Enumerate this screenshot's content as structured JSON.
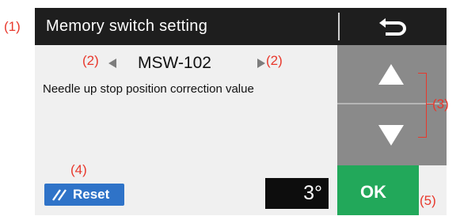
{
  "window": {
    "title": "Memory switch setting",
    "back_icon": "return-arrow-icon"
  },
  "switch": {
    "id": "MSW-102",
    "prev_icon": "triangle-left-icon",
    "next_icon": "triangle-right-icon",
    "description": "Needle up stop position correction value"
  },
  "actions": {
    "reset_label": "Reset",
    "reset_icon": "reset-slash-icon",
    "ok_label": "OK",
    "up_icon": "triangle-up-icon",
    "down_icon": "triangle-down-icon"
  },
  "value": {
    "display": "3°"
  },
  "callouts": {
    "c1": "(1)",
    "c2_left": "(2)",
    "c2_right": "(2)",
    "c3": "(3)",
    "c4": "(4)",
    "c5": "(5)"
  },
  "colors": {
    "title_bg": "#1e1e1e",
    "panel_bg": "#f0f0f0",
    "nav_bg": "#8a8a8a",
    "reset_blue": "#2f73c8",
    "ok_green": "#22a85a",
    "value_bg": "#0d0d0d",
    "callout_red": "#e8382c"
  }
}
